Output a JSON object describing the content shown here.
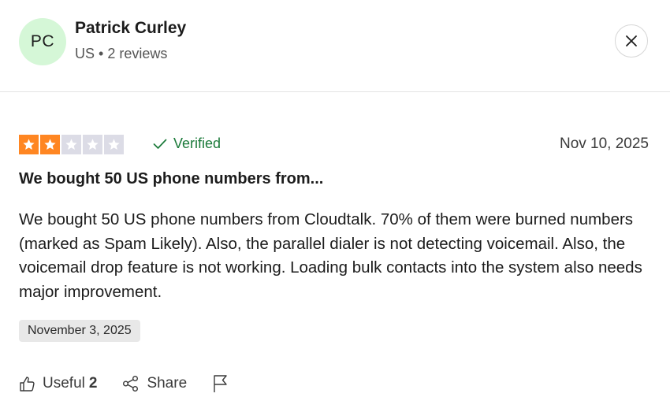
{
  "reviewer": {
    "initials": "PC",
    "name": "Patrick Curley",
    "country": "US",
    "separator": "•",
    "reviews": "2 reviews",
    "avatar_color": "#d5f7d7"
  },
  "close": {
    "icon": "close-icon"
  },
  "review": {
    "rating": 2,
    "max_rating": 5,
    "star_color_filled": "#ff8622",
    "star_color_empty": "#dcdce6",
    "verified_label": "Verified",
    "verified_color": "#1b7a3a",
    "date": "Nov 10, 2025",
    "title": "We bought 50 US phone numbers from...",
    "body": "We bought 50 US phone numbers from Cloudtalk. 70% of them were burned numbers (marked as Spam Likely). Also, the parallel dialer is not detecting voicemail. Also, the voicemail drop feature is not working. Loading bulk contacts into the system also needs major improvement.",
    "experience_date": "November 3, 2025"
  },
  "actions": {
    "useful_label": "Useful",
    "useful_count": "2",
    "share_label": "Share",
    "useful_icon": "thumbs-up-icon",
    "share_icon": "share-icon",
    "report_icon": "flag-icon"
  }
}
